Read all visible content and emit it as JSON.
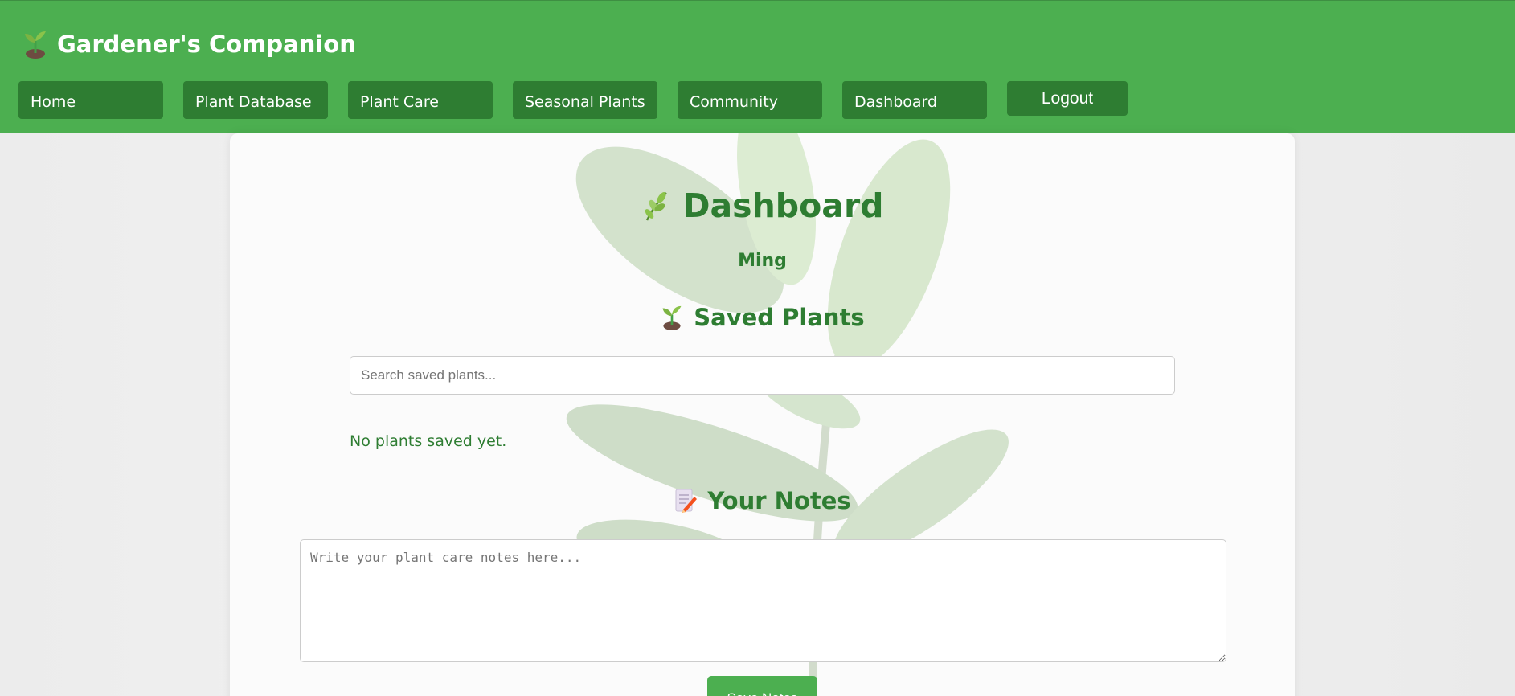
{
  "header": {
    "brand_title": "Gardener's Companion",
    "brand_icon": "seedling-icon",
    "nav": [
      {
        "label": "Home"
      },
      {
        "label": "Plant Database"
      },
      {
        "label": "Plant Care"
      },
      {
        "label": "Seasonal Plants"
      },
      {
        "label": "Community"
      },
      {
        "label": "Dashboard"
      }
    ],
    "logout_label": "Logout"
  },
  "dashboard": {
    "title": "Dashboard",
    "title_icon": "herb-icon",
    "username": "Ming",
    "saved_plants": {
      "title": "Saved Plants",
      "icon": "seedling-icon",
      "search_placeholder": "Search saved plants...",
      "search_value": "",
      "empty_message": "No plants saved yet."
    },
    "notes": {
      "title": "Your Notes",
      "icon": "memo-icon",
      "placeholder": "Write your plant care notes here...",
      "value": "",
      "save_label": "Save Notes"
    }
  },
  "colors": {
    "header_bg": "#4caf50",
    "nav_bg": "#2e7d32",
    "heading_green": "#2e7d32"
  }
}
